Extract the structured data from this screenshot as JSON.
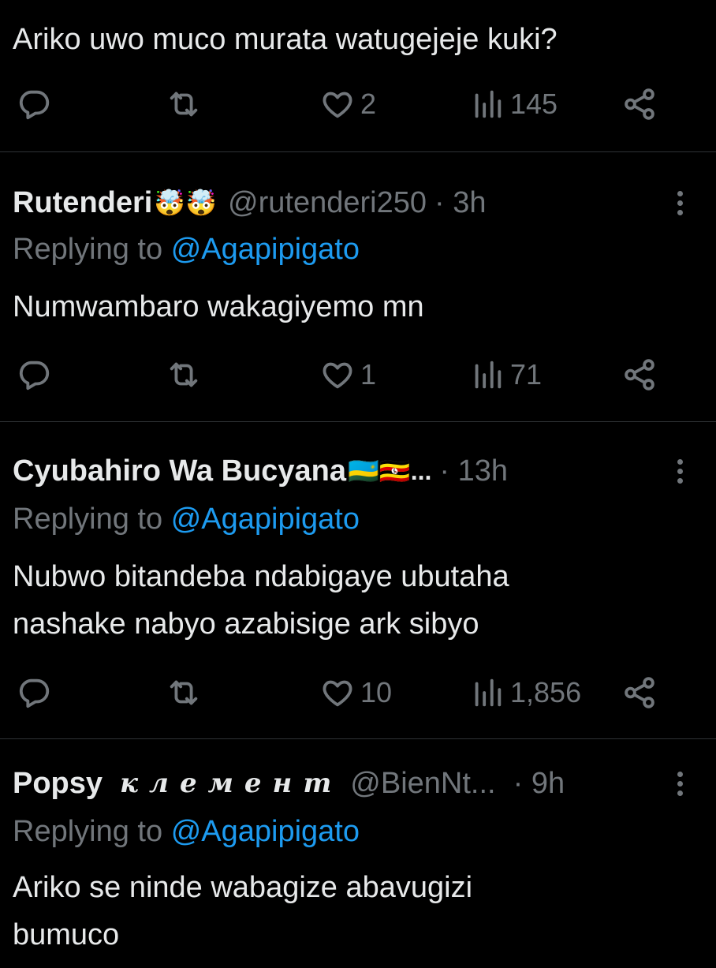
{
  "tweets": [
    {
      "text": "Ariko uwo muco murata watugejeje kuki?",
      "stats": {
        "likes": "2",
        "views": "145"
      }
    },
    {
      "name": "Rutenderi",
      "emoji": "🤯🤯",
      "handle": "@rutenderi250",
      "time": "· 3h",
      "replying_prefix": "Replying to",
      "replying_to": "@Agapipigato",
      "text": "Numwambaro wakagiyemo mn",
      "stats": {
        "likes": "1",
        "views": "71"
      }
    },
    {
      "name": "Cyubahiro Wa Bucyana",
      "emoji": "🇷🇼🇺🇬...",
      "time": "· 13h",
      "replying_prefix": "Replying to",
      "replying_to": "@Agapipigato",
      "text_line1": "Nubwo bitandeba ndabigaye ubutaha",
      "text_line2": "nashake nabyo azabisige ark sibyo",
      "stats": {
        "likes": "10",
        "views": "1,856"
      }
    },
    {
      "name": "Popsy",
      "name_extra": "клемент",
      "handle": "@BienNt...",
      "time": "· 9h",
      "replying_prefix": "Replying to",
      "replying_to": "@Agapipigato",
      "text_line1": "Ariko se ninde wabagize abavugizi",
      "text_line2": "bumuco"
    }
  ],
  "icons": {
    "reply": "reply-icon",
    "retweet": "retweet-icon",
    "like": "heart-icon",
    "views": "views-icon",
    "share": "share-icon",
    "more": "more-icon"
  },
  "colors": {
    "background": "#000000",
    "text": "#e7e9ea",
    "muted": "#71767b",
    "link": "#1d9bf0",
    "divider": "#2f3336"
  }
}
